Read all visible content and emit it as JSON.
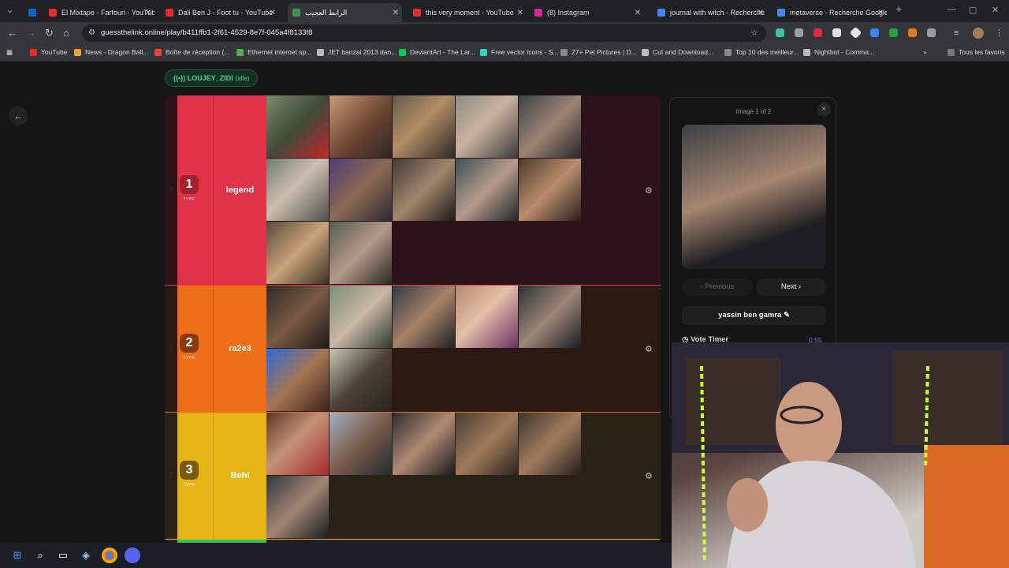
{
  "browser": {
    "tabs": [
      {
        "label": "El Mixtape - Farfouri - YouTube",
        "color": "#e52d27"
      },
      {
        "label": "Dali Ben J - Foot tu - YouTube",
        "color": "#e52d27"
      },
      {
        "label": "الرابط العجيب",
        "color": "#3f8f52"
      },
      {
        "label": "this very moment - YouTube",
        "color": "#e52d27"
      },
      {
        "label": "(8) Instagram",
        "color": "#d6249f"
      },
      {
        "label": "journal with witch - Recherche",
        "color": "#4285f4"
      },
      {
        "label": "metaverse - Recherche Google",
        "color": "#4285f4"
      }
    ],
    "new_tab_glyph": "+",
    "url": "guessthelink.online/play/b411ffb1-2f61-4529-8e7f-045a4f8133f8",
    "bookmarks": [
      {
        "label": "YouTube",
        "color": "#e52d27"
      },
      {
        "label": "News - Dragon Ball...",
        "color": "#f0a030"
      },
      {
        "label": "Boîte de réception (...",
        "color": "#e8453c"
      },
      {
        "label": "Ethernet internet sp...",
        "color": "#4caf50"
      },
      {
        "label": "JET banzai 2013 dan...",
        "color": "#bbbbbb"
      },
      {
        "label": "DeviantArt - The Lar...",
        "color": "#05cc47"
      },
      {
        "label": "Free vector icons - S...",
        "color": "#2dd4bf"
      },
      {
        "label": "27+ Pet Pictures | D...",
        "color": "#888888"
      },
      {
        "label": "Cut and Download...",
        "color": "#bbbbbb"
      },
      {
        "label": "Top 10 des meilleur...",
        "color": "#888888"
      },
      {
        "label": "Nightbot - Comma...",
        "color": "#bbbbbb"
      }
    ],
    "bookmarks_more": "»",
    "all_bookmarks": "Tous les favoris"
  },
  "page": {
    "user": {
      "name": "LOUJEY_ZIDI",
      "status": "(idle)"
    },
    "type_label": "TYPE",
    "tiers": [
      {
        "number": "1",
        "name": "legend",
        "color": "#e0334a",
        "badge_color": "#a3202f",
        "bg": "#2a1419",
        "rows": 3,
        "images": [
          {
            "bg": "linear-gradient(135deg,#7d8a6e,#3e4a36 50%,#c4262e)"
          },
          {
            "bg": "linear-gradient(135deg,#c89b76,#6b4432 55%,#2f2420)"
          },
          {
            "bg": "linear-gradient(135deg,#5e5b4c,#b58d66 45%,#2d2a25)"
          },
          {
            "bg": "linear-gradient(135deg,#8c8c86,#c9b39e 45%,#3b3b3d)"
          },
          {
            "bg": "linear-gradient(135deg,#3a4248,#9d8472 50%,#25292c)"
          },
          {
            "bg": "linear-gradient(135deg,#6e7a70,#cdbfae 45%,#4c514c)"
          },
          {
            "bg": "linear-gradient(135deg,#4d3c7a,#8b6a52 50%,#2c2a35)"
          },
          {
            "bg": "linear-gradient(135deg,#3f3a33,#a1866c 50%,#1c1a18)"
          },
          {
            "bg": "linear-gradient(135deg,#3b4f55,#b59c8b 50%,#1e2729)"
          },
          {
            "bg": "linear-gradient(135deg,#4a3a2c,#b98c6c 50%,#2a2018)"
          },
          {
            "bg": "linear-gradient(135deg,#5a4a3a,#c9a27a 50%,#3a2f22)"
          },
          {
            "bg": "linear-gradient(135deg,#575a52,#b29a86 50%,#2a2a26)"
          }
        ]
      },
      {
        "number": "2",
        "name": "ra2e3",
        "color": "#ee6d17",
        "badge_color": "#8a3a10",
        "bg": "#2b1a14",
        "rows": 2,
        "images": [
          {
            "bg": "linear-gradient(135deg,#2f2b25,#7a5a44 50%,#1b1915)"
          },
          {
            "bg": "linear-gradient(135deg,#7d8e74,#c8b7a4 50%,#2c3a2e)"
          },
          {
            "bg": "linear-gradient(135deg,#2e3c46,#a78068 50%,#1d2227)"
          },
          {
            "bg": "linear-gradient(135deg,#b3886f,#e4c0a7 45%,#6a2f63)"
          },
          {
            "bg": "linear-gradient(135deg,#2c3235,#9c8677 50%,#1a1e22)"
          },
          {
            "bg": "linear-gradient(135deg,#2a6bd8,#a77552 50%,#3b2218)"
          },
          {
            "bg": "linear-gradient(135deg,#c7c9b4,#4a4038 50%,#2a2622)"
          }
        ]
      },
      {
        "number": "3",
        "name": "Behi",
        "color": "#e6b417",
        "badge_color": "#7a5a10",
        "bg": "#2a2218",
        "rows": 2,
        "images": [
          {
            "bg": "linear-gradient(135deg,#5b3726,#c49277 45%,#a8282c)"
          },
          {
            "bg": "linear-gradient(135deg,#9fb2c6,#7a5d4c 50%,#232a33)"
          },
          {
            "bg": "linear-gradient(135deg,#2a2c30,#b28a72 50%,#17191c)"
          },
          {
            "bg": "linear-gradient(135deg,#463d32,#a07a5a 50%,#2b251e)"
          },
          {
            "bg": "linear-gradient(135deg,#3a3630,#a27b5d 50%,#231f1a)"
          },
          {
            "bg": "linear-gradient(135deg,#2d3840,#a48570 50%,#171c20)"
          }
        ]
      }
    ],
    "next_tier_color": "#3ec25a",
    "panel": {
      "count_text": "Image 1 of 2",
      "close_glyph": "×",
      "prev_label": "‹   Previous",
      "next_label": "Next   ›",
      "person_name": "yassin ben gamra ✎",
      "vote_label": "Vote Timer",
      "vote_time": "0:55",
      "photo_bg": "linear-gradient(160deg,#3b3f44,#a58670 45%,#1e1f22 75%)"
    }
  },
  "webcam": {
    "bg": "linear-gradient(160deg,#2c2b3f,#5a4540 40%,#cfc9c4 75%,#cfc9c4)"
  }
}
